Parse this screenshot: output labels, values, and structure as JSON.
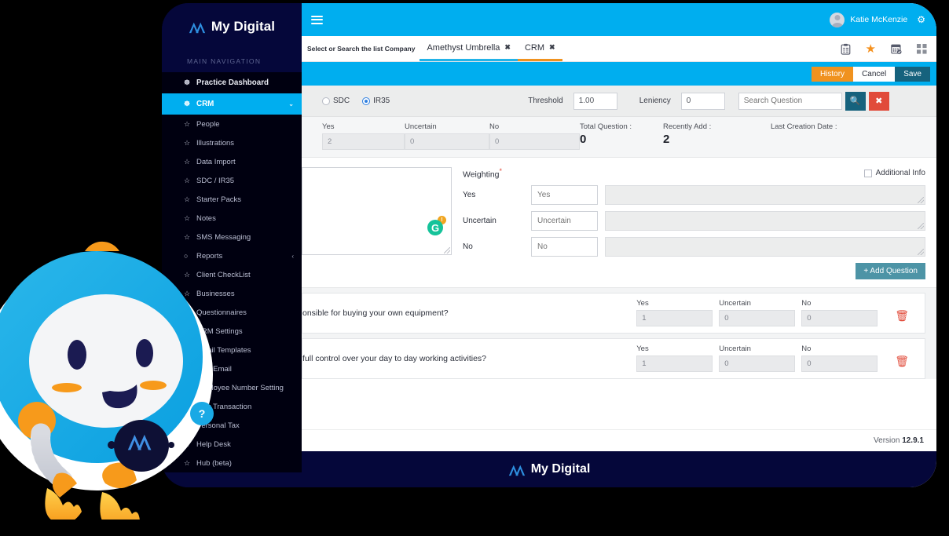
{
  "brand": {
    "name": "My Digital",
    "footer_name": "My Digital"
  },
  "sidebar": {
    "heading": "MAIN NAVIGATION",
    "items": [
      {
        "label": "Practice Dashboard",
        "icon": "dashboard-icon",
        "level": 1,
        "active": false
      },
      {
        "label": "CRM",
        "icon": "crm-icon",
        "level": 1,
        "active": true,
        "chevron": "⌄"
      },
      {
        "label": "People",
        "icon": "star-icon",
        "level": 2
      },
      {
        "label": "Illustrations",
        "icon": "star-icon",
        "level": 2
      },
      {
        "label": "Data Import",
        "icon": "star-icon",
        "level": 2
      },
      {
        "label": "SDC / IR35",
        "icon": "star-icon",
        "level": 2
      },
      {
        "label": "Starter Packs",
        "icon": "star-icon",
        "level": 2
      },
      {
        "label": "Notes",
        "icon": "star-icon",
        "level": 2
      },
      {
        "label": "SMS Messaging",
        "icon": "star-icon",
        "level": 2
      },
      {
        "label": "Reports",
        "icon": "circle-icon",
        "level": 2,
        "chevron": "‹"
      },
      {
        "label": "Client CheckList",
        "icon": "star-icon",
        "level": 2
      },
      {
        "label": "Businesses",
        "icon": "star-icon",
        "level": 2
      },
      {
        "label": "Questionnaires",
        "icon": "star-icon",
        "level": 2
      },
      {
        "label": "CRM Settings",
        "icon": "star-icon",
        "level": 2
      },
      {
        "label": "Email Templates",
        "icon": "star-icon",
        "level": 2
      },
      {
        "label": "Bulk Email",
        "icon": "star-icon",
        "level": 2
      },
      {
        "label": "Employee Number Setting",
        "icon": "star-icon",
        "level": 2
      },
      {
        "label": "Bulk Transaction",
        "icon": "star-icon",
        "level": 2
      },
      {
        "label": "Personal Tax",
        "icon": "star-icon",
        "level": 2
      },
      {
        "label": "Help Desk",
        "icon": "star-icon",
        "level": 2
      },
      {
        "label": "Hub (beta)",
        "icon": "star-icon",
        "level": 2
      }
    ]
  },
  "topbar": {
    "menu_icon": "hamburger-icon",
    "user_name": "Katie McKenzie",
    "settings_icon": "gear-icon"
  },
  "tabstrip": {
    "hint": "Select or Search the list Company",
    "tabs": [
      {
        "label": "Amethyst Umbrella",
        "close": "✖",
        "accent": "blue"
      },
      {
        "label": "CRM",
        "close": "✖",
        "accent": "orange"
      }
    ],
    "icons": [
      {
        "name": "clipboard-icon",
        "glyph": "📋"
      },
      {
        "name": "star-icon",
        "glyph": "★"
      },
      {
        "name": "calendar-check-icon",
        "glyph": "📅"
      },
      {
        "name": "grid-icon",
        "glyph": "▒"
      }
    ]
  },
  "actionbar": {
    "history_label": "History",
    "cancel_label": "Cancel",
    "save_label": "Save"
  },
  "filterbar": {
    "radio_sdc": "SDC",
    "radio_ir35": "IR35",
    "selected": "IR35",
    "threshold_label": "Threshold",
    "threshold_value": "1.00",
    "leniency_label": "Leniency",
    "leniency_value": "0",
    "search_placeholder": "Search Question",
    "search_value": "",
    "search_icon": "search-icon",
    "clear_icon": "close-icon"
  },
  "stats": {
    "yes_label": "Yes",
    "yes_value": "2",
    "uncertain_label": "Uncertain",
    "uncertain_value": "0",
    "no_label": "No",
    "no_value": "0",
    "total_label": "Total Question :",
    "total_value": "0",
    "recent_label": "Recently Add :",
    "recent_value": "2",
    "lastdate_label": "Last Creation Date :",
    "lastdate_value": ""
  },
  "editor": {
    "question_value": "",
    "grammarly_icon": "grammarly-icon",
    "grammarly_letter": "G",
    "grammarly_badge": "!",
    "weighting_title": "Weighting",
    "required_mark": "*",
    "additional_info_label": "Additional Info",
    "additional_info_checked": false,
    "rows": [
      {
        "label": "Yes",
        "placeholder": "Yes",
        "value": "",
        "note": ""
      },
      {
        "label": "Uncertain",
        "placeholder": "Uncertain",
        "value": "",
        "note": ""
      },
      {
        "label": "No",
        "placeholder": "No",
        "value": "",
        "note": ""
      }
    ],
    "add_question_label": "+ Add Question"
  },
  "questions": {
    "col_yes": "Yes",
    "col_uncertain": "Uncertain",
    "col_no": "No",
    "delete_icon": "trash-icon",
    "rows": [
      {
        "text": "onsible for buying your own equipment?",
        "yes": "1",
        "uncertain": "0",
        "no": "0"
      },
      {
        "text": "full control over your day to day working activities?",
        "yes": "1",
        "uncertain": "0",
        "no": "0"
      }
    ]
  },
  "footer": {
    "version_label": "Version",
    "version_value": "12.9.1"
  },
  "mascot": {
    "name": "rocket-robot-mascot",
    "help_badge": "?"
  },
  "colors": {
    "brand_navy": "#05073a",
    "accent_cyan": "#00aeef",
    "accent_orange": "#f0921f",
    "save_teal": "#16627d",
    "danger_red": "#e14b3a",
    "addq_teal": "#4d94a6"
  }
}
